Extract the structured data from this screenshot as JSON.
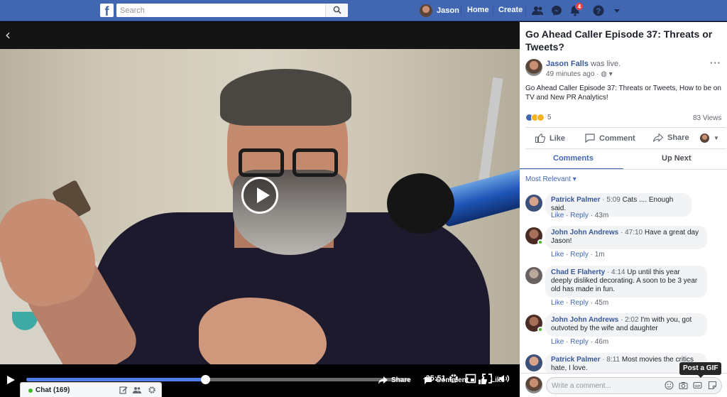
{
  "topbar": {
    "logo": "f",
    "search_placeholder": "Search",
    "user_name": "Jason",
    "home_label": "Home",
    "create_label": "Create",
    "notification_count": "4",
    "brand_color": "#4267b2"
  },
  "video": {
    "time_remaining": "-25:51",
    "progress": 0.465,
    "share_label": "Share",
    "comment_label": "Comment",
    "like_label": "Like"
  },
  "chat": {
    "label": "Chat (169)"
  },
  "post": {
    "title": "Go Ahead Caller Episode 37: Threats or Tweets?",
    "author": "Jason Falls",
    "author_suffix": " was live.",
    "time_ago": "49 minutes ago",
    "description": "Go Ahead Caller Episode 37: Threats or Tweets, How to be on TV and New PR Analytics!",
    "reaction_count": "5",
    "views": "83 Views",
    "actions": {
      "like": "Like",
      "comment": "Comment",
      "share": "Share"
    },
    "tabs": {
      "comments": "Comments",
      "up_next": "Up Next"
    },
    "sort_label": "Most Relevant"
  },
  "comments": [
    {
      "name": "Patrick Palmer",
      "time": "5:09",
      "text": "Cats .... Enough said.",
      "like": "Like",
      "reply": "Reply",
      "age": "43m"
    },
    {
      "name": "John John Andrews",
      "time": "47:10",
      "text": "Have a great day Jason!",
      "like": "Like",
      "reply": "Reply",
      "age": "1m"
    },
    {
      "name": "Chad E Flaherty",
      "time": "4:14",
      "text": "Up until this year deeply disliked decorating. A soon to be 3 year old has made in fun.",
      "like": "Like",
      "reply": "Reply",
      "age": "45m"
    },
    {
      "name": "John John Andrews",
      "time": "2:02",
      "text": "I'm with you, got outvoted by the wife and daughter",
      "like": "Like",
      "reply": "Reply",
      "age": "46m"
    },
    {
      "name": "Patrick Palmer",
      "time": "8:11",
      "text": "Most movies the critics hate, I love.",
      "like": "Like",
      "reply": "Reply",
      "age": ""
    }
  ],
  "composer": {
    "placeholder": "Write a comment...",
    "gif_tooltip": "Post a GIF"
  }
}
